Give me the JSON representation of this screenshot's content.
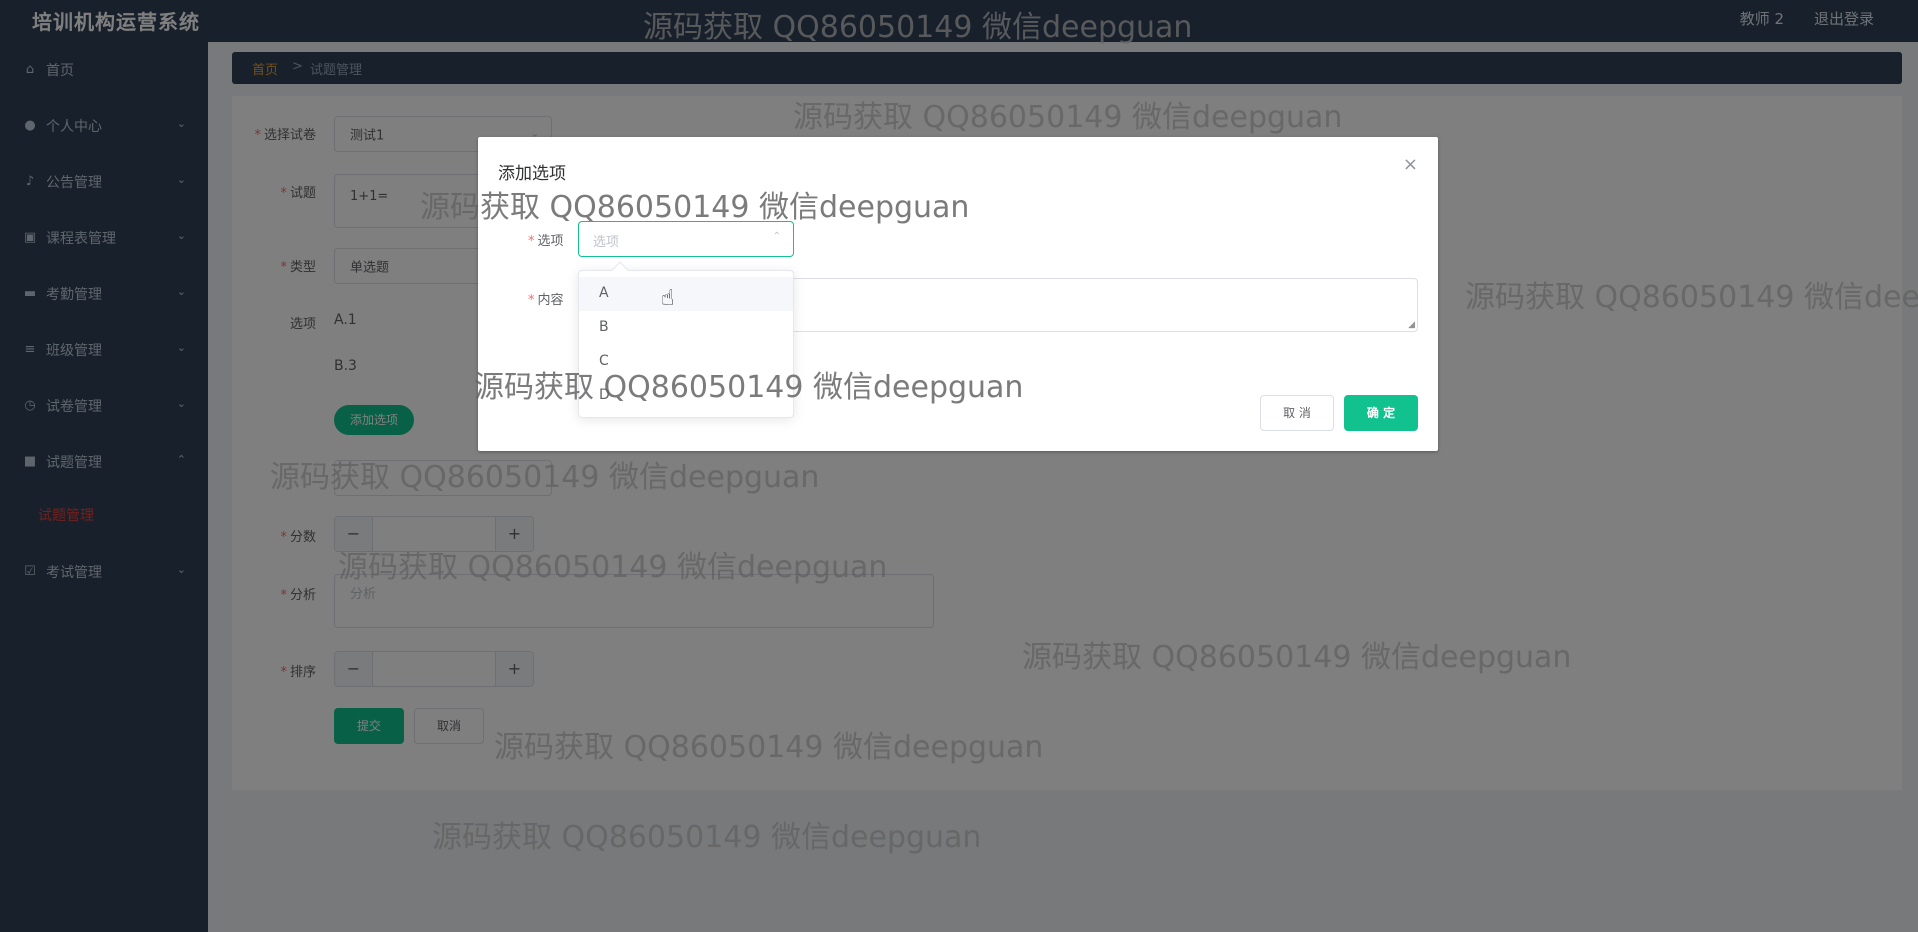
{
  "header": {
    "brand": "培训机构运营系统",
    "user": "教师 2",
    "logout": "退出登录"
  },
  "sidebar": {
    "items": [
      {
        "label": "首页",
        "icon": "home-icon",
        "glyph": "⌂",
        "arrow": ""
      },
      {
        "label": "个人中心",
        "icon": "user-icon",
        "glyph": "●",
        "arrow": "⌄"
      },
      {
        "label": "公告管理",
        "icon": "microphone-icon",
        "glyph": "♪",
        "arrow": "⌄"
      },
      {
        "label": "课程表管理",
        "icon": "briefcase-icon",
        "glyph": "▣",
        "arrow": "⌄"
      },
      {
        "label": "考勤管理",
        "icon": "monitor-icon",
        "glyph": "▬",
        "arrow": "⌄"
      },
      {
        "label": "班级管理",
        "icon": "sliders-icon",
        "glyph": "≡",
        "arrow": "⌄"
      },
      {
        "label": "试卷管理",
        "icon": "clock-icon",
        "glyph": "◷",
        "arrow": "⌄"
      },
      {
        "label": "试题管理",
        "icon": "cube-icon",
        "glyph": "■",
        "arrow": "⌃"
      },
      {
        "label": "考试管理",
        "icon": "clipboard-check-icon",
        "glyph": "☑",
        "arrow": "⌄"
      }
    ],
    "subitem": "试题管理"
  },
  "breadcrumb": {
    "home": "首页",
    "sep": ">",
    "current": "试题管理"
  },
  "form": {
    "paper_label": "选择试卷",
    "paper_value": "测试1",
    "question_label": "试题",
    "question_value": "1+1=",
    "type_label": "类型",
    "type_value": "单选题",
    "options_label": "选项",
    "option_a": "A.1",
    "option_b": "B.3",
    "add_option": "添加选项",
    "score_label": "分数",
    "analysis_label": "分析",
    "analysis_placeholder": "分析",
    "order_label": "排序",
    "submit": "提交",
    "cancel": "取消",
    "stepper_minus": "−",
    "stepper_plus": "+"
  },
  "dialog": {
    "title": "添加选项",
    "close": "×",
    "option_label": "选项",
    "option_placeholder": "选项",
    "content_label": "内容",
    "cancel": "取 消",
    "confirm": "确 定"
  },
  "dropdown": {
    "options": [
      "A",
      "B",
      "C",
      "D"
    ]
  },
  "watermark": "源码获取 QQ86050149 微信deepguan",
  "colors": {
    "sidebar": "#304156",
    "accent": "#11c28f",
    "active_menu": "#e4423c",
    "breadcrumb_home": "#e6a23c"
  }
}
